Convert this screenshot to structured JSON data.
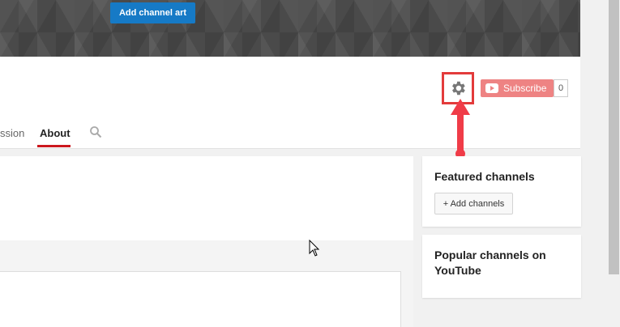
{
  "banner": {
    "add_art_label": "Add channel art"
  },
  "tabs": [
    {
      "label": "ssion"
    },
    {
      "label": "About"
    }
  ],
  "subscribe": {
    "label": "Subscribe",
    "count": "0"
  },
  "sidebar": {
    "featured": {
      "title": "Featured channels",
      "button_label": "+ Add channels"
    },
    "popular": {
      "title": "Popular channels on YouTube"
    }
  },
  "colors": {
    "accent_blue": "#167ac6",
    "subscribe_red": "#ee8383",
    "highlight_red": "#e33b3b",
    "tab_underline": "#cc181e"
  },
  "icons": [
    "gear-icon",
    "search-icon",
    "youtube-play-icon",
    "annotation-arrow",
    "mouse-cursor"
  ]
}
